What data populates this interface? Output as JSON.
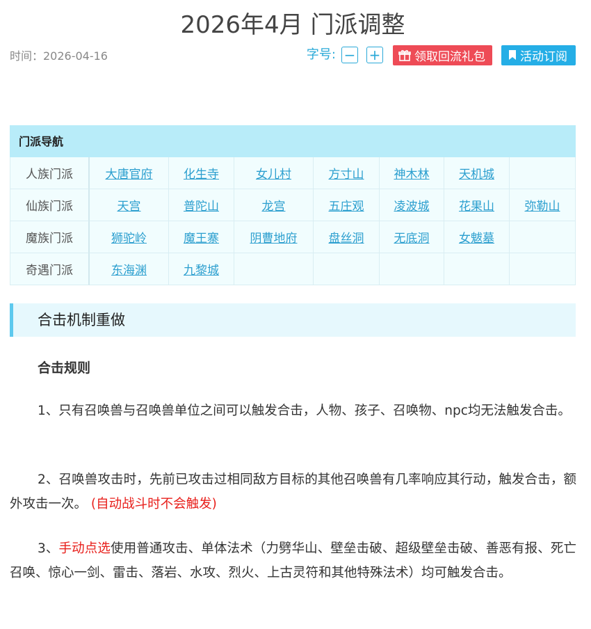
{
  "page": {
    "title": "2026年4月 门派调整",
    "time": "时间：2026-04-16"
  },
  "toolbar": {
    "font_label": "字号:",
    "minus": "−",
    "plus": "+",
    "gift_label": "领取回流礼包",
    "subscribe_label": "活动订阅"
  },
  "nav": {
    "title": "门派导航",
    "rows": [
      {
        "label": "人族门派",
        "items": [
          "大唐官府",
          "化生寺",
          "女儿村",
          "方寸山",
          "神木林",
          "天机城",
          ""
        ]
      },
      {
        "label": "仙族门派",
        "items": [
          "天宫",
          "普陀山",
          "龙宫",
          "五庄观",
          "凌波城",
          "花果山",
          "弥勒山"
        ]
      },
      {
        "label": "魔族门派",
        "items": [
          "狮驼岭",
          "魔王寨",
          "阴曹地府",
          "盘丝洞",
          "无底洞",
          "女魃墓",
          ""
        ]
      },
      {
        "label": "奇遇门派",
        "items": [
          "东海渊",
          "九黎城",
          "",
          "",
          "",
          "",
          ""
        ]
      }
    ]
  },
  "content": {
    "section_title": "合击机制重做",
    "subtitle": "合击规则",
    "p1": "1、只有召唤兽与召唤兽单位之间可以触发合击，人物、孩子、召唤物、npc均无法触发合击。",
    "p2": "2、召唤兽攻击时，先前已攻击过相同敌方目标的其他召唤兽有几率响应其行动，触发合击，额外攻击一次。",
    "p2_note": "(自动战斗时不会触发)",
    "p3_prefix": "3、",
    "p3_highlight": "手动点选",
    "p3_rest": "使用普通攻击、单体法术（力劈华山、壁垒击破、超级壁垒击破、善恶有报、死亡召唤、惊心一剑、雷击、落岩、水攻、烈火、上古灵符和其他特殊法术）均可触发合击。"
  },
  "colors": {
    "accent": "#2aa9d8",
    "gift": "#ee4b56",
    "subscribe": "#25aee6",
    "nav_header": "#b8ecf9",
    "highlight_red": "#e8201c"
  }
}
